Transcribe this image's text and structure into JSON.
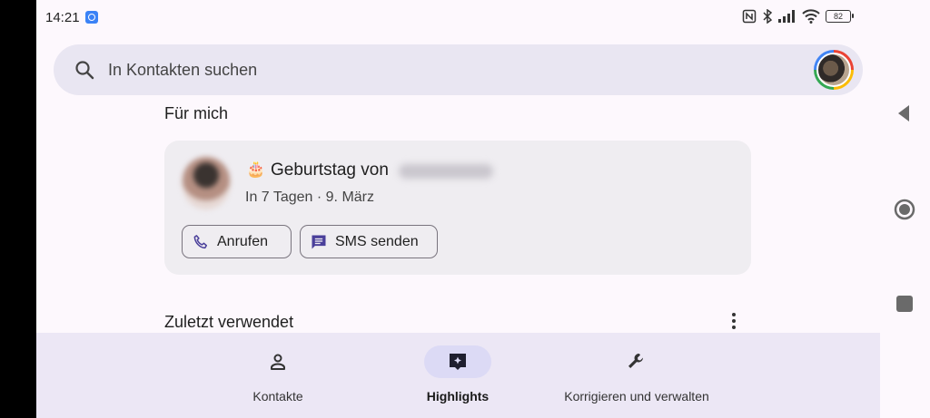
{
  "status": {
    "time": "14:21",
    "battery": "82"
  },
  "search": {
    "placeholder": "In Kontakten suchen"
  },
  "sections": {
    "for_me": "Für mich",
    "recent": "Zuletzt verwendet"
  },
  "birthday_card": {
    "title": "Geburtstag von",
    "subtitle": "In 7 Tagen · 9. März",
    "call_label": "Anrufen",
    "sms_label": "SMS senden"
  },
  "bottom_nav": {
    "items": [
      {
        "label": "Kontakte",
        "icon": "person-icon",
        "active": false
      },
      {
        "label": "Highlights",
        "icon": "highlights-icon",
        "active": true
      },
      {
        "label": "Korrigieren und verwalten",
        "icon": "wrench-icon",
        "active": false
      }
    ]
  },
  "system_nav": {
    "icons": [
      "back-icon",
      "home-icon",
      "recents-icon"
    ]
  },
  "colors": {
    "background": "#fdf8fd",
    "search_bg": "#e9e6f2",
    "card_bg": "#efedf1",
    "nav_bg": "#ece7f5",
    "active_pill": "#dcdaf5",
    "chip_icon": "#4a3f9a"
  }
}
